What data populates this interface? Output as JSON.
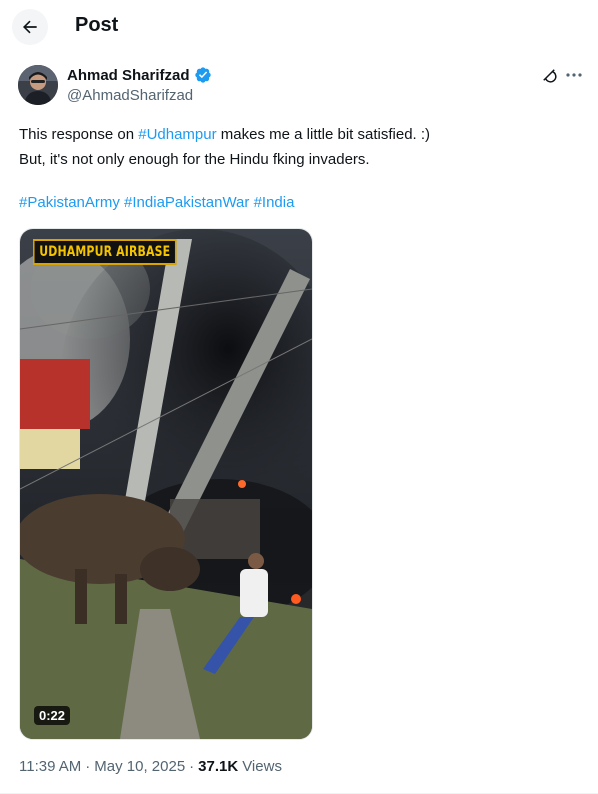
{
  "header": {
    "title": "Post",
    "back_icon": "arrow-left-icon"
  },
  "author": {
    "name": "Ahmad Sharifzad",
    "handle": "@AhmadSharifzad",
    "verified": true,
    "verified_color": "#1d9bf0"
  },
  "tweet": {
    "line1_before": "This response on ",
    "line1_tag": "#Udhampur",
    "line1_after": " makes me a little bit satisfied. :)",
    "line2": "But, it's not only enough for the Hindu fking invaders.",
    "tags": [
      "#PakistanArmy",
      "#IndiaPakistanWar",
      "#India"
    ]
  },
  "video": {
    "overlay_label": "UDHAMPUR AIRBASE",
    "duration": "0:22"
  },
  "meta": {
    "time": "11:39 AM",
    "separator": "·",
    "date": "May 10, 2025",
    "views_count": "37.1K",
    "views_label": "Views"
  },
  "colors": {
    "link": "#1d9bf0",
    "text": "#0f1419",
    "secondary": "#536471"
  }
}
